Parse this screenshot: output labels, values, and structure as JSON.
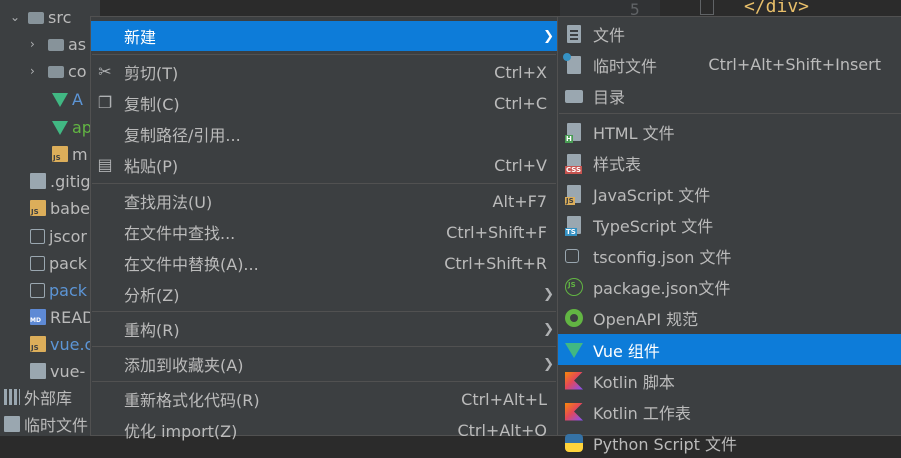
{
  "tree": {
    "src_label": "src",
    "items": [
      {
        "label": "as"
      },
      {
        "label": "co"
      },
      {
        "label": "A"
      },
      {
        "label": "ap"
      },
      {
        "label": "m"
      },
      {
        "label": ".gitig"
      },
      {
        "label": "babe"
      },
      {
        "label": "jscor"
      },
      {
        "label": "pack"
      },
      {
        "label": "pack"
      },
      {
        "label": "READ"
      },
      {
        "label": "vue.c"
      },
      {
        "label": "vue-"
      },
      {
        "label": "外部库"
      },
      {
        "label": "临时文件"
      }
    ]
  },
  "editor": {
    "line_number": "5",
    "code_text": "</div>"
  },
  "context_menu": {
    "items": [
      {
        "label": "新建",
        "shortcut": "",
        "submenu": true
      },
      {
        "label": "剪切(T)",
        "shortcut": "Ctrl+X"
      },
      {
        "label": "复制(C)",
        "shortcut": "Ctrl+C"
      },
      {
        "label": "复制路径/引用...",
        "shortcut": ""
      },
      {
        "label": "粘贴(P)",
        "shortcut": "Ctrl+V"
      },
      {
        "label": "查找用法(U)",
        "shortcut": "Alt+F7"
      },
      {
        "label": "在文件中查找...",
        "shortcut": "Ctrl+Shift+F"
      },
      {
        "label": "在文件中替换(A)...",
        "shortcut": "Ctrl+Shift+R"
      },
      {
        "label": "分析(Z)",
        "shortcut": "",
        "submenu": true
      },
      {
        "label": "重构(R)",
        "shortcut": "",
        "submenu": true
      },
      {
        "label": "添加到收藏夹(A)",
        "shortcut": "",
        "submenu": true
      },
      {
        "label": "重新格式化代码(R)",
        "shortcut": "Ctrl+Alt+L"
      },
      {
        "label": "优化 import(Z)",
        "shortcut": "Ctrl+Alt+O"
      }
    ]
  },
  "new_submenu": {
    "items": [
      {
        "label": "文件",
        "shortcut": ""
      },
      {
        "label": "临时文件",
        "shortcut": "Ctrl+Alt+Shift+Insert"
      },
      {
        "label": "目录",
        "shortcut": ""
      },
      {
        "label": "HTML 文件",
        "shortcut": ""
      },
      {
        "label": "样式表",
        "shortcut": ""
      },
      {
        "label": "JavaScript 文件",
        "shortcut": ""
      },
      {
        "label": "TypeScript 文件",
        "shortcut": ""
      },
      {
        "label": "tsconfig.json 文件",
        "shortcut": ""
      },
      {
        "label": "package.json文件",
        "shortcut": ""
      },
      {
        "label": "OpenAPI 规范",
        "shortcut": ""
      },
      {
        "label": "Vue 组件",
        "shortcut": ""
      },
      {
        "label": "Kotlin 脚本",
        "shortcut": ""
      },
      {
        "label": "Kotlin 工作表",
        "shortcut": ""
      },
      {
        "label": "Python Script 文件",
        "shortcut": ""
      }
    ]
  },
  "colors": {
    "selection": "#0d7cd9",
    "menu_bg": "#3c3f41",
    "vue_green": "#41b883"
  }
}
